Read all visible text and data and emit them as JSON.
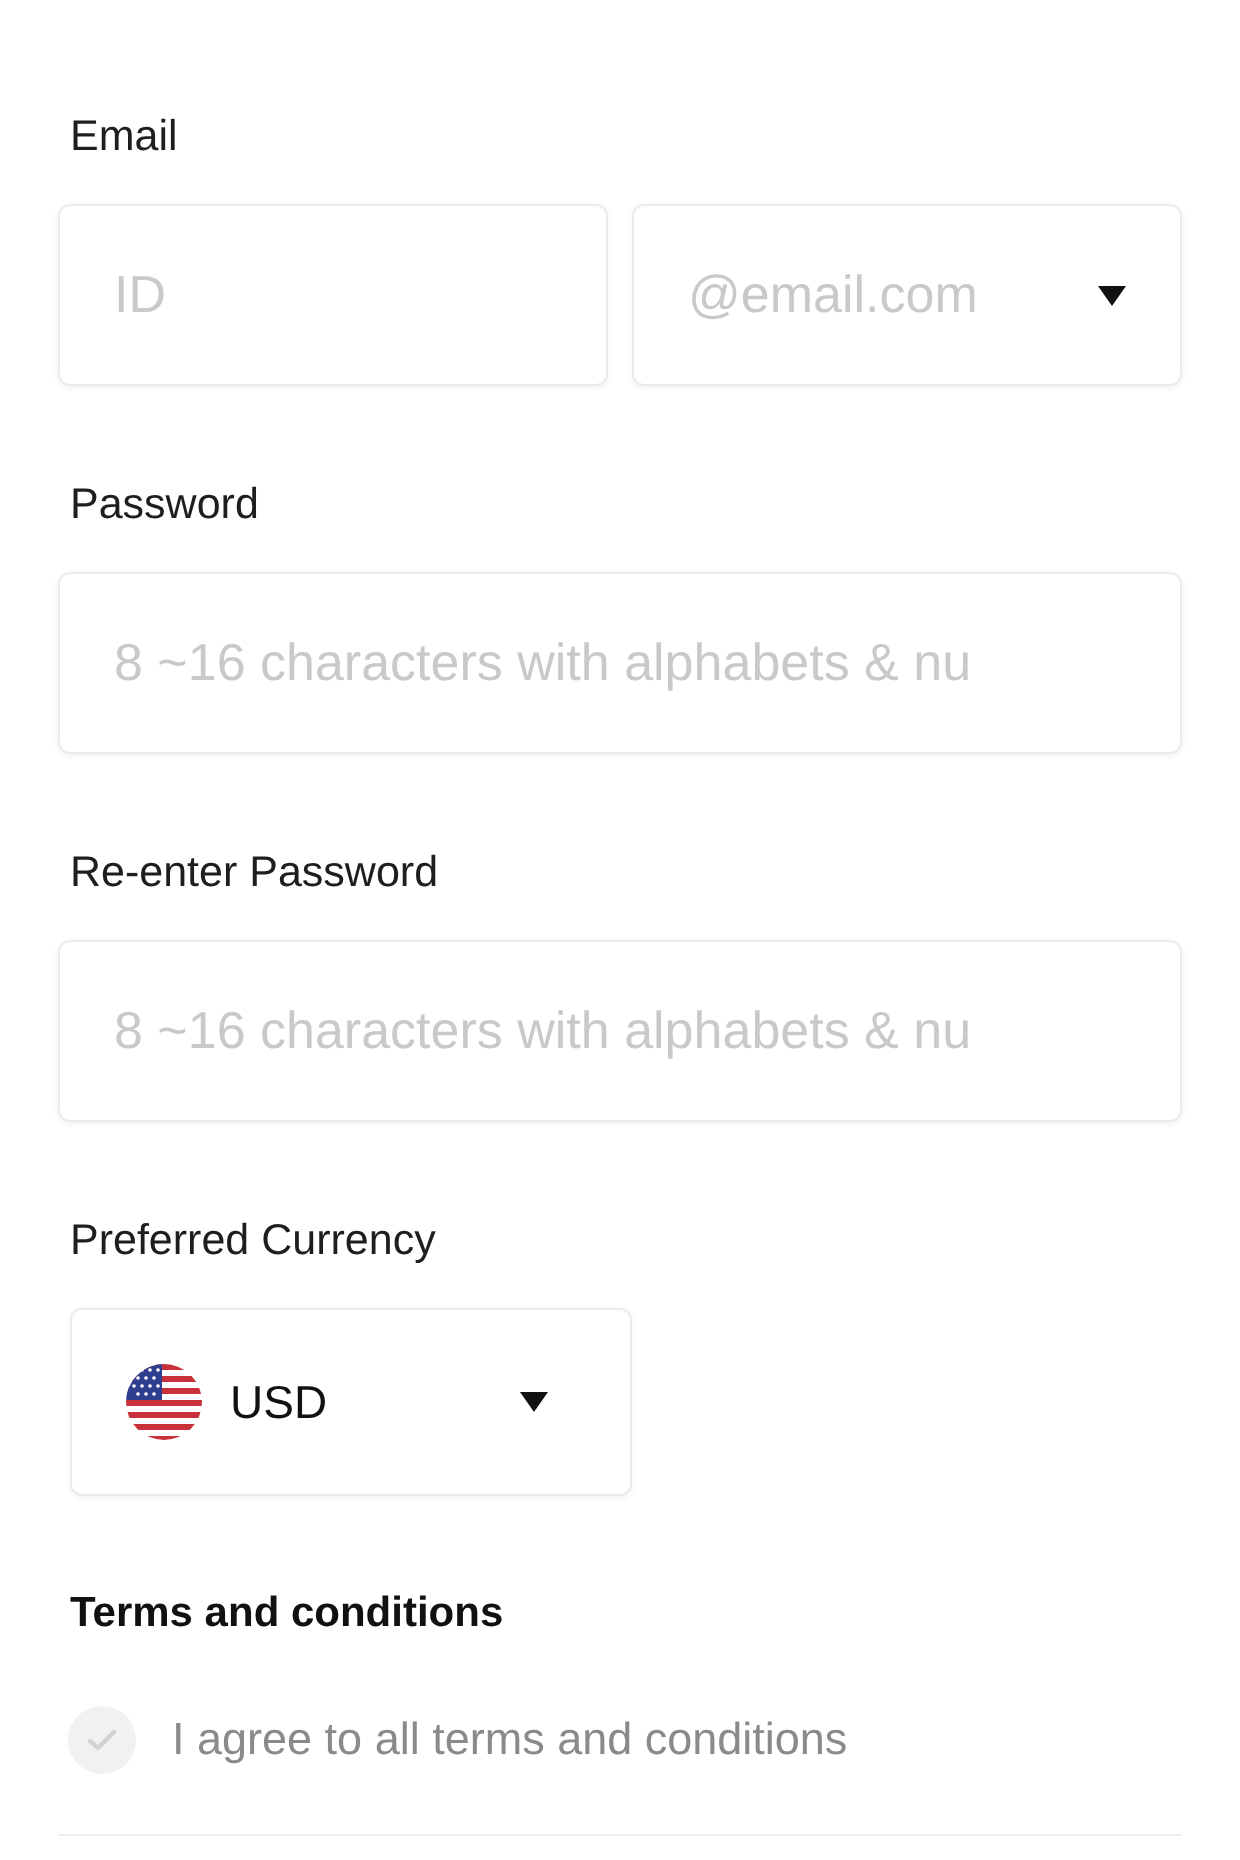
{
  "email": {
    "label": "Email",
    "id_field": {
      "placeholder": "ID"
    },
    "domain_dropdown": {
      "placeholder": "@email.com"
    }
  },
  "password": {
    "label": "Password",
    "placeholder": "8 ~16 characters with alphabets & nu"
  },
  "confirm_password": {
    "label": "Re-enter Password",
    "placeholder": "8 ~16 characters with alphabets & nu"
  },
  "currency": {
    "label": "Preferred Currency",
    "value": "USD"
  },
  "terms": {
    "title": "Terms and conditions",
    "agree_all": {
      "label": "I agree to all terms and conditions",
      "checked": false
    }
  }
}
